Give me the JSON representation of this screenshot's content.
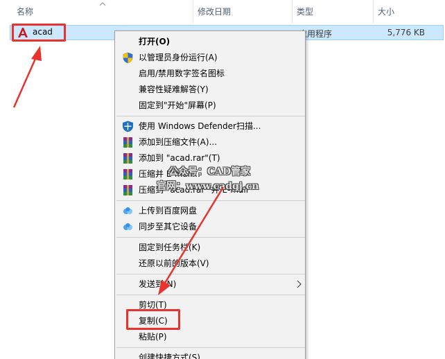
{
  "columns": {
    "name": "名称",
    "date_modified": "修改日期",
    "type": "类型",
    "size": "大小"
  },
  "file": {
    "name": "acad",
    "type": "应用程序",
    "size": "5,776 KB",
    "icon": "autocad-icon"
  },
  "menu": {
    "items": [
      {
        "label": "打开(O)",
        "bold": true
      },
      {
        "label": "以管理员身份运行(A)",
        "icon": "uac-shield-icon"
      },
      {
        "label": "启用/禁用数字签名图标"
      },
      {
        "label": "兼容性疑难解答(Y)"
      },
      {
        "label": "固定到\"开始\"屏幕(P)"
      },
      {
        "label": "使用 Windows Defender扫描...",
        "icon": "windows-defender-icon"
      },
      {
        "label": "添加到压缩文件(A)...",
        "icon": "winrar-icon"
      },
      {
        "label": "添加到 \"acad.rar\"(T)",
        "icon": "winrar-icon"
      },
      {
        "label": "压缩并 E-mail...",
        "icon": "winrar-icon"
      },
      {
        "label": "压缩到 \"acad.rar\" 并 E-mail",
        "icon": "winrar-icon"
      },
      {
        "label": "上传到百度网盘",
        "icon": "baidu-netdisk-icon"
      },
      {
        "label": "同步至其它设备",
        "icon": "baidu-netdisk-icon"
      },
      {
        "label": "固定到任务栏(K)"
      },
      {
        "label": "还原以前的版本(V)"
      },
      {
        "label": "发送到(N)",
        "submenu": true
      },
      {
        "label": "剪切(T)"
      },
      {
        "label": "复制(C)"
      },
      {
        "label": "粘贴(P)"
      },
      {
        "label": "创建快捷方式(S)"
      }
    ]
  },
  "watermark": {
    "line1": "公众号：CAD管家",
    "line2": "官网：www.cadgj.cn"
  },
  "colors": {
    "highlight_red": "#e8322b",
    "selection_bg": "#cce8ff",
    "selection_border": "#99d1ff",
    "menu_bg": "#f2f2f2"
  }
}
